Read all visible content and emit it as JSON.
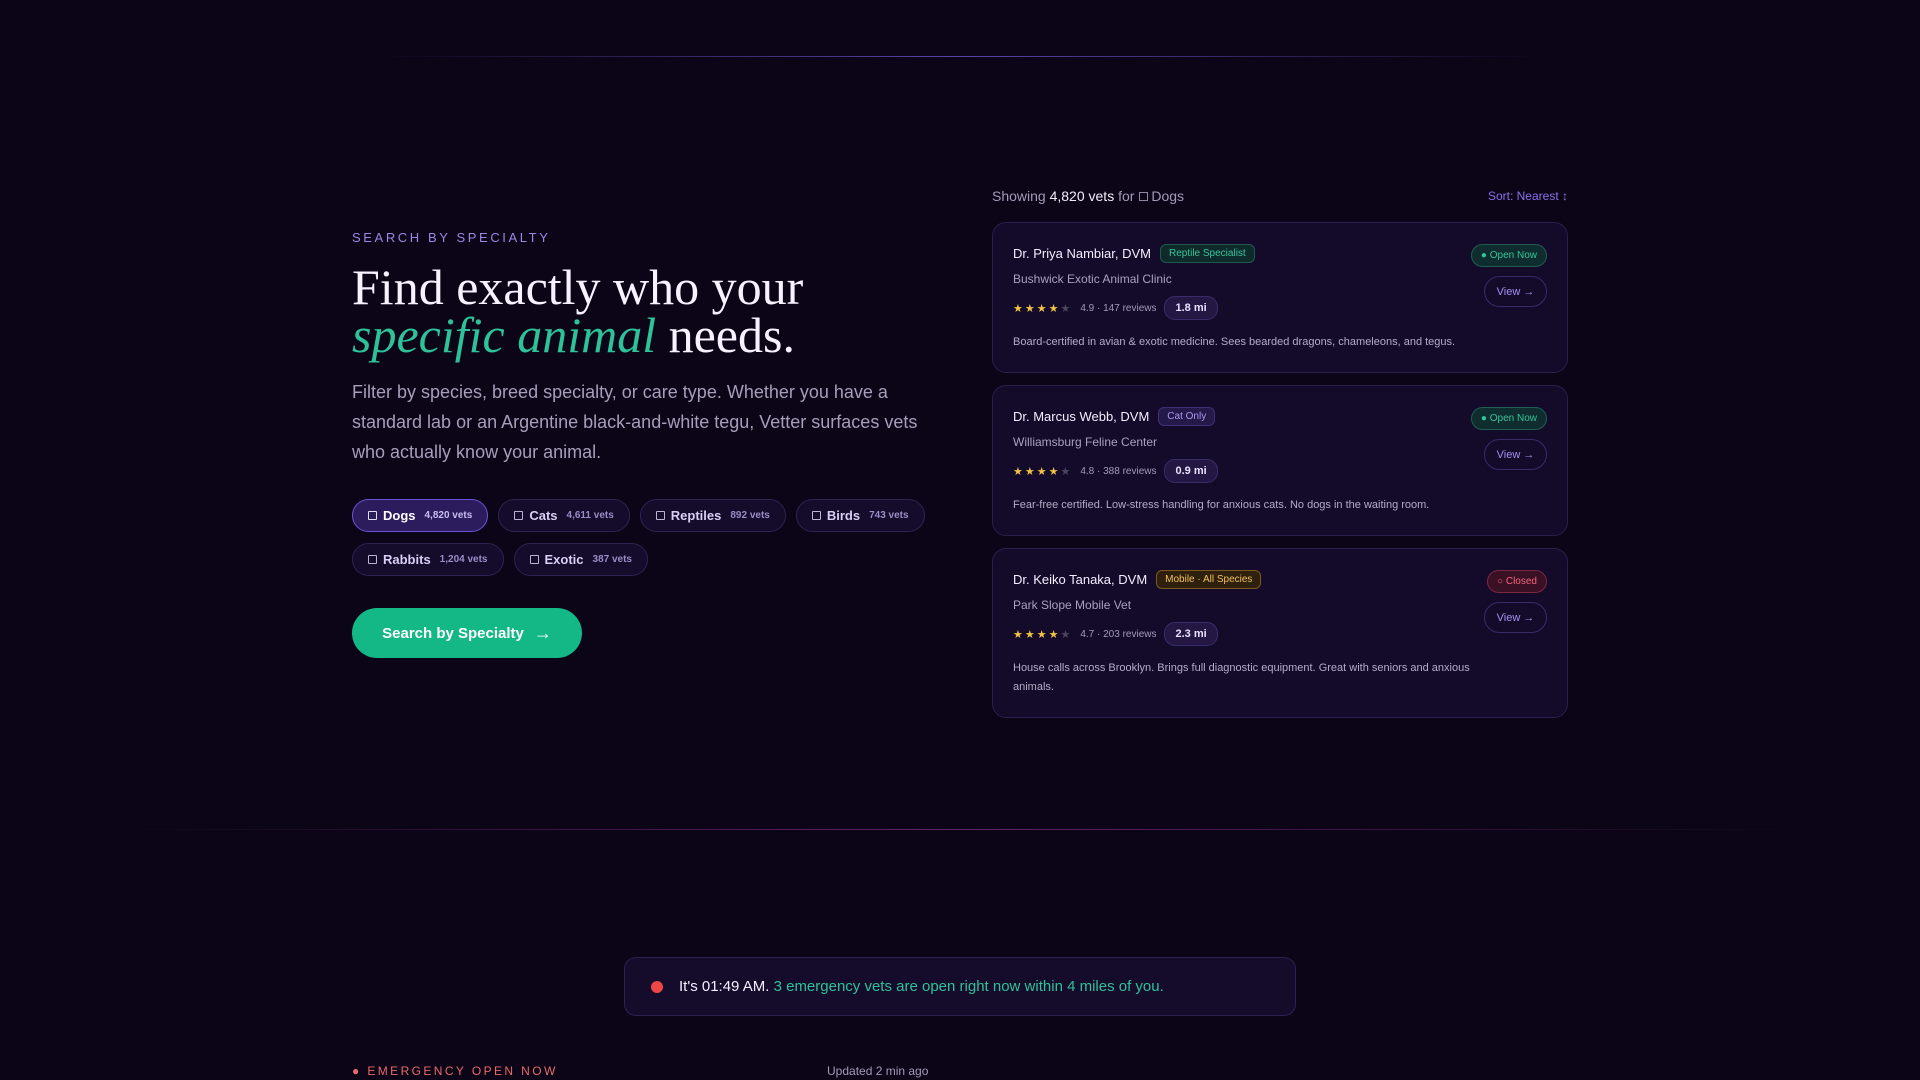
{
  "hero": {
    "eyebrow": "SEARCH BY SPECIALTY",
    "headline_line1": "Find exactly who your",
    "headline_accent": "specific animal",
    "headline_end": " needs.",
    "subtext": "Filter by species, breed specialty, or care type. Whether you have a standard lab or an Argentine black-and-white tegu, Vetter surfaces vets who actually know your animal.",
    "chips": [
      {
        "label": "Dogs",
        "count": "4,820 vets",
        "active": true
      },
      {
        "label": "Cats",
        "count": "4,611 vets",
        "active": false
      },
      {
        "label": "Reptiles",
        "count": "892 vets",
        "active": false
      },
      {
        "label": "Birds",
        "count": "743 vets",
        "active": false
      },
      {
        "label": "Rabbits",
        "count": "1,204 vets",
        "active": false
      },
      {
        "label": "Exotic",
        "count": "387 vets",
        "active": false
      }
    ],
    "cta_label": "Search by Specialty",
    "cta_arrow": "→"
  },
  "results": {
    "showing_prefix": "Showing",
    "showing_count": "4,820 vets",
    "showing_for": "for",
    "showing_species": "Dogs",
    "sort_label": "Sort: Nearest ↕",
    "cards": [
      {
        "name": "Dr. Priya Nambiar, DVM",
        "badge": "Reptile Specialist",
        "badge_color": "green",
        "clinic": "Bushwick Exotic Animal Clinic",
        "stars": 4,
        "rating_text": "4.9 · 147 reviews",
        "distance": "1.8 mi",
        "description": "Board-certified in avian & exotic medicine. Sees bearded dragons, chameleons, and tegus.",
        "status": "● Open Now",
        "status_type": "open",
        "view_label": "View →"
      },
      {
        "name": "Dr. Marcus Webb, DVM",
        "badge": "Cat Only",
        "badge_color": "purple",
        "clinic": "Williamsburg Feline Center",
        "stars": 4,
        "rating_text": "4.8 · 388 reviews",
        "distance": "0.9 mi",
        "description": "Fear-free certified. Low-stress handling for anxious cats. No dogs in the waiting room.",
        "status": "● Open Now",
        "status_type": "open",
        "view_label": "View →"
      },
      {
        "name": "Dr. Keiko Tanaka, DVM",
        "badge": "Mobile · All Species",
        "badge_color": "amber",
        "clinic": "Park Slope Mobile Vet",
        "stars": 4,
        "rating_text": "4.7 · 203 reviews",
        "distance": "2.3 mi",
        "description": "House calls across Brooklyn. Brings full diagnostic equipment. Great with seniors and anxious animals.",
        "status": "○ Closed",
        "status_type": "closed",
        "view_label": "View →"
      }
    ]
  },
  "alert": {
    "time_text": "It's 01:49 AM.",
    "highlight_text": " 3 emergency vets are open right now within 4 miles of you."
  },
  "emergency": {
    "label": "● EMERGENCY OPEN NOW",
    "updated": "Updated 2 min ago"
  },
  "colors": {
    "background": "#0c0518",
    "accent_green": "#2ec29a",
    "cta_green": "#14b886",
    "accent_purple": "#8a70e8",
    "alert_red": "#ee4545"
  }
}
